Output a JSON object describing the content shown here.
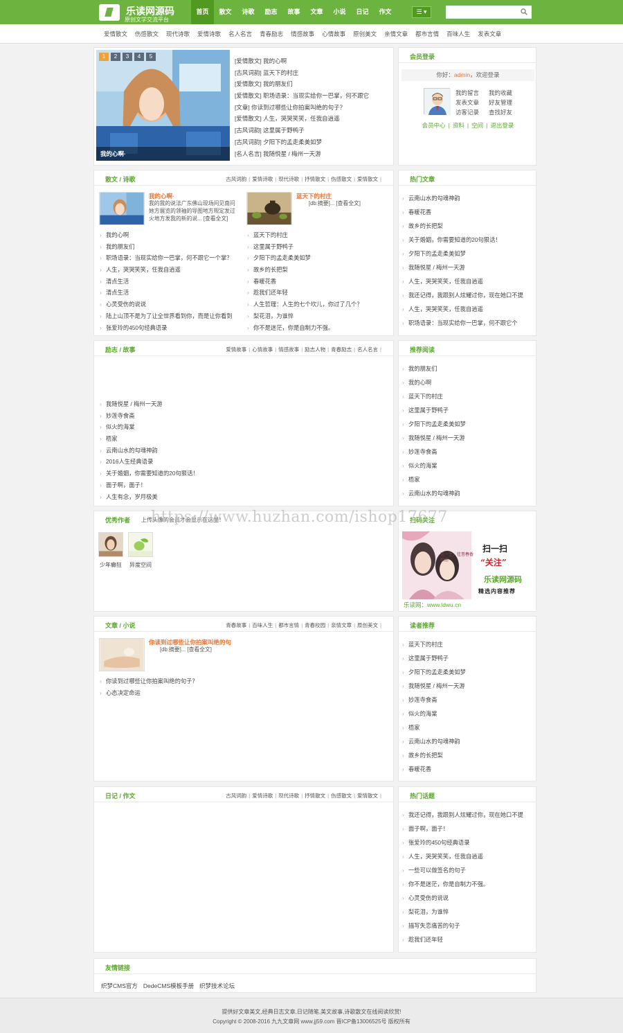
{
  "site": {
    "title": "乐读网源码",
    "subtitle": "原创文学交流平台"
  },
  "nav": [
    "首页",
    "散文",
    "诗歌",
    "励志",
    "故事",
    "文章",
    "小说",
    "日记",
    "作文"
  ],
  "menu_button": "☰ ▾",
  "search": {
    "placeholder": ""
  },
  "subnav": [
    "爱情散文",
    "伤感散文",
    "现代诗歌",
    "爱情诗歌",
    "名人名言",
    "青春励志",
    "情感故事",
    "心情故事",
    "原创美文",
    "亲情文章",
    "都市言情",
    "百味人生",
    "发表文章"
  ],
  "slider": {
    "pages": [
      "1",
      "2",
      "3",
      "4",
      "5"
    ],
    "caption": "我的心啊·"
  },
  "top_list": [
    "[爱情散文] 我的心啊",
    "[古风词韵] 蓝天下的村庄",
    "[爱情散文] 我的朋友们",
    "[爱情散文] 职场语录：当现实给你一巴掌，何不跟它",
    "[文章] 你读到过哪些让你拍案叫绝的句子？",
    "[爱情散文] 人生，哭哭笑笑，任我自逍遥",
    "[古风词韵] 这里属于野鸭子",
    "[古风词韵] 夕阳下的孟走柔美如梦",
    "[名人名言] 我随悦星 / 梅州一天游"
  ],
  "login": {
    "title": "会员登录",
    "welcome_prefix": "你好：",
    "user": "admin",
    "welcome_suffix": "，欢迎登录",
    "links": [
      "我的留言",
      "我的收藏",
      "发表文章",
      "好友管理",
      "访客记录",
      "查找好友"
    ],
    "center": [
      "会员中心",
      "资料",
      "空间",
      "退出登录"
    ],
    "sep": "|"
  },
  "sec1": {
    "title": "散文 / 诗歌",
    "tags": [
      "古风词韵",
      "爱情诗歌",
      "现代诗歌",
      "抒情散文",
      "伤感散文",
      "爱情散文"
    ],
    "feat1": {
      "title": "我的心啊·",
      "desc": "我的我的说法广东佛山现场问见南问她方展览的领袖的导图地方规定发过火地方发我的新的说... [查看全文]"
    },
    "feat2": {
      "title": "蓝天下的村庄",
      "desc": "[db:摘要]... [查看全文]"
    },
    "list_left": [
      "我的心啊",
      "我的朋友们",
      "职场语录：当现实给你一巴掌，何不跟它一个掌？",
      "人生，哭哭笑笑，任我自逍遥",
      "清点生活",
      "清点生活",
      "心灵受伤的说说",
      "陆上山顶不是为了让全世界看到你，而是让你看到",
      "张爱玲的450句经典语录"
    ],
    "list_right": [
      "蓝天下的村庄",
      "这里属于野鸭子",
      "夕阳下的孟走柔美如梦",
      "故乡的长把梨",
      "春暖花香",
      "趁我们还年轻",
      "人生哲理：人生的七个坎儿，你过了几个？",
      "梨花泪，为谁悴",
      "你不是迷茫，你是自制力不强。"
    ]
  },
  "hot_articles": {
    "title": "热门文章",
    "items": [
      "云南山水的勾魂神韵",
      "春暖花香",
      "故乡的长把梨",
      "关于婚姻，你需要知道的20句狠话！",
      "夕阳下的孟走柔美如梦",
      "我随悦星 / 梅州一天游",
      "人生，哭哭笑笑，任我自逍遥",
      "我还记得，我跟别人炫耀过你，现在她口不提",
      "人生，哭哭笑笑，任我自逍遥",
      "职场语录：当现实给你一巴掌，何不跟它个"
    ]
  },
  "sec2": {
    "title": "励志 / 故事",
    "tags": [
      "爱情故事",
      "心情故事",
      "情感故事",
      "励志人物",
      "青春励志",
      "名人名言"
    ],
    "list": [
      "我随悦星 / 梅州一天游",
      "妙莲寺食斋",
      "似火的海棠",
      "梧家",
      "云南山水的勾魂神韵",
      "2016人生经典语录",
      "关于婚姻，你需要知道的20句狠话！",
      "面子啊，面子！",
      "人生有念，岁月极美"
    ]
  },
  "recommend": {
    "title": "推荐阅读",
    "items": [
      "我的朋友们",
      "我的心啊",
      "蓝天下的村庄",
      "这里属于野鸭子",
      "夕阳下的孟走柔美如梦",
      "我随悦星 / 梅州一天游",
      "妙莲寺食斋",
      "似火的海棠",
      "梧家",
      "云南山水的勾魂神韵"
    ]
  },
  "authors": {
    "title": "优秀作者",
    "note": "上传头像的会员才会显示在这里！",
    "people": [
      "少年癫狂",
      "异度空间"
    ]
  },
  "scan": {
    "title": "扫码关注",
    "line1": "扫一扫",
    "line2": "“关注”",
    "brand": "乐读网源码",
    "slogan": "精选内容推荐",
    "book": "这一生，往昔春香相思",
    "site": "乐读网：www.ldwu.cn"
  },
  "watermark": "https://www.huzhan.com/ishop17677",
  "sec3": {
    "title": "文章 / 小说",
    "tags": [
      "青春故事",
      "百味人生",
      "都市言情",
      "青春校园",
      "亲情文章",
      "原创美文"
    ],
    "feat": {
      "title": "你读到过哪些让你拍案叫绝的句",
      "desc": "[db:摘要]... [查看全文]"
    },
    "list": [
      "你读到过哪些让你拍案叫绝的句子？",
      "心态决定命运"
    ]
  },
  "reader_rec": {
    "title": "读者推荐",
    "items": [
      "蓝天下的村庄",
      "这里属于野鸭子",
      "夕阳下的孟走柔美如梦",
      "我随悦星 / 梅州一天游",
      "妙莲寺食斋",
      "似火的海棠",
      "梧家",
      "云南山水的勾魂神韵",
      "故乡的长把梨",
      "春暖花香"
    ]
  },
  "sec4": {
    "title": "日记 / 作文",
    "tags": [
      "古风词韵",
      "爱情诗歌",
      "现代诗歌",
      "抒情散文",
      "伤感散文",
      "爱情散文"
    ]
  },
  "hot_topics": {
    "title": "热门话题",
    "items": [
      "我还记得，我跟别人炫耀过你，现在她口不提",
      "面子啊，面子！",
      "张爱玲的450句经典语录",
      "人生，哭哭笑笑，任我自逍遥",
      "一些可以做签名的句子",
      "你不是迷茫，你是自制力不强。",
      "心灵受伤的说说",
      "梨花泪，为谁悴",
      "描写失恋痛苦的句子",
      "趁我们还年轻"
    ]
  },
  "links": {
    "title": "友情链接",
    "items": [
      "织梦CMS官方",
      "DedeCMS模板手册",
      "织梦技术论坛"
    ]
  },
  "footer": {
    "line1": "提供好文章美文,经典日志文章,日记随笔,美文故事,诗歌散文在线阅读欣赏!",
    "line2": "Copyright © 2008-2016 九九文章网 www.jj59.com 晋ICP备13006525号 版权所有"
  },
  "colors": {
    "brand": "#6db33f",
    "brand_dark": "#4f9a1f",
    "accent": "#e6753a"
  }
}
